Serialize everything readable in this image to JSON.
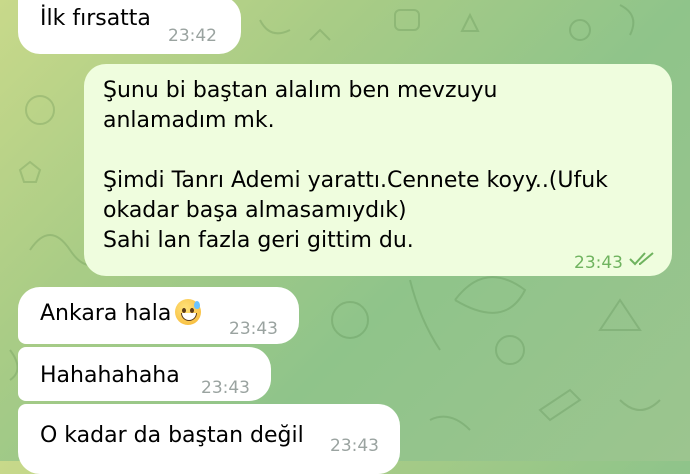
{
  "messages": [
    {
      "id": "m1",
      "direction": "incoming",
      "text": "İlk fırsatta",
      "time": "23:42"
    },
    {
      "id": "m2",
      "direction": "outgoing",
      "text": "Şunu bi baştan alalım ben mevzuyu\nanlamadım mk.\n\nŞimdi Tanrı Ademi yarattı.Cennete koyy..(Ufuk\nokadar başa almasamıydık)\nSahi lan fazla geri gittim du.",
      "time": "23:43",
      "status": "read"
    },
    {
      "id": "m3",
      "direction": "incoming",
      "text": "Ankara hala",
      "emoji": "sweat-smile-emoji",
      "time": "23:43"
    },
    {
      "id": "m4",
      "direction": "incoming",
      "text": "Hahahahaha",
      "time": "23:43"
    },
    {
      "id": "m5",
      "direction": "incoming",
      "text": "O kadar da baştan değil",
      "time": "23:43"
    }
  ],
  "colors": {
    "incoming_bubble": "#ffffff",
    "outgoing_bubble": "#effdde",
    "read_ticks": "#6fb35f",
    "timestamp": "#9aa3a0"
  }
}
